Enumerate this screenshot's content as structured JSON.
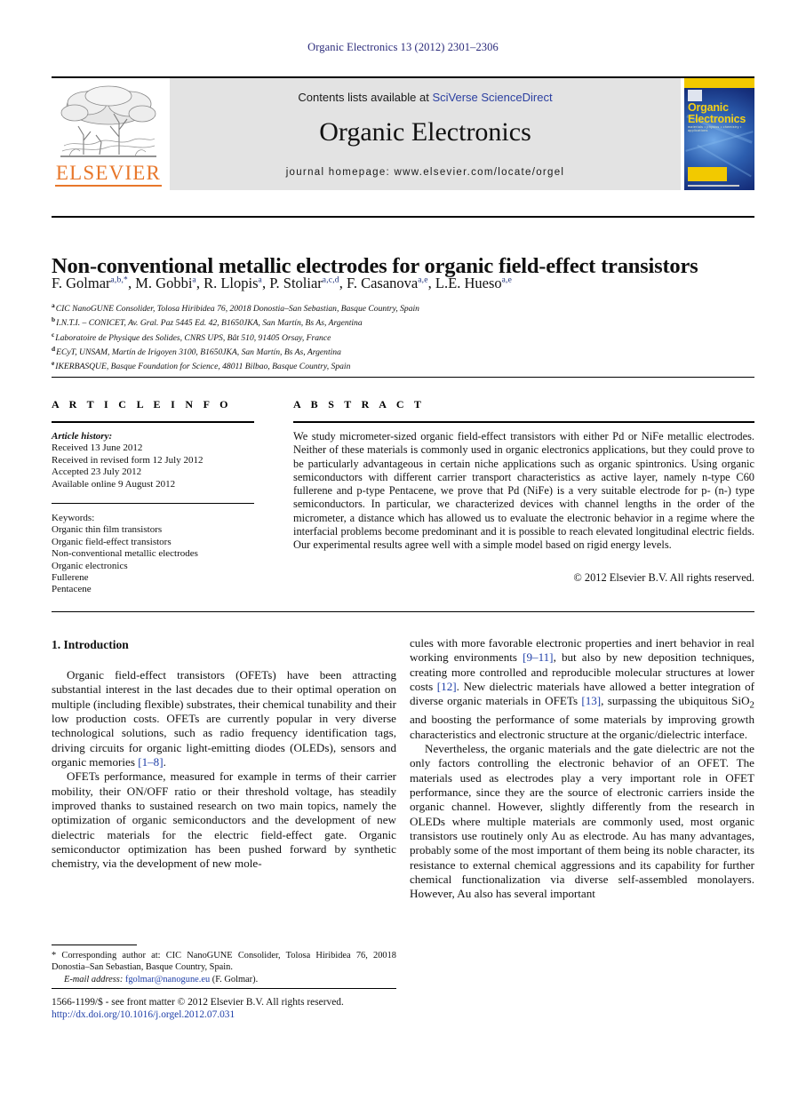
{
  "running_head": "Organic Electronics 13 (2012) 2301–2306",
  "masthead": {
    "contents_prefix": "Contents lists available at ",
    "contents_link": "SciVerse ScienceDirect",
    "journal_name": "Organic Electronics",
    "homepage": "journal homepage: www.elsevier.com/locate/orgel",
    "publisher_logo_text": "ELSEVIER",
    "cover": {
      "title_line1": "Organic",
      "title_line2": "Electronics",
      "subtitle": "materials • physics • chemistry • applications"
    }
  },
  "article": {
    "title": "Non-conventional metallic electrodes for organic field-effect transistors",
    "authors": [
      {
        "name": "F. Golmar",
        "sup": "a,b,*"
      },
      {
        "name": "M. Gobbi",
        "sup": "a"
      },
      {
        "name": "R. Llopis",
        "sup": "a"
      },
      {
        "name": "P. Stoliar",
        "sup": "a,c,d"
      },
      {
        "name": "F. Casanova",
        "sup": "a,e"
      },
      {
        "name": "L.E. Hueso",
        "sup": "a,e"
      }
    ],
    "affiliations": [
      {
        "mark": "a",
        "text": "CIC NanoGUNE Consolider, Tolosa Hiribidea 76, 20018 Donostia–San Sebastian, Basque Country, Spain"
      },
      {
        "mark": "b",
        "text": "I.N.T.I. – CONICET, Av. Gral. Paz 5445 Ed. 42, B1650JKA, San Martín, Bs As, Argentina"
      },
      {
        "mark": "c",
        "text": "Laboratoire de Physique des Solides, CNRS UPS, Bât 510, 91405 Orsay, France"
      },
      {
        "mark": "d",
        "text": "ECyT, UNSAM, Martín de Irigoyen 3100, B1650JKA, San Martín, Bs As, Argentina"
      },
      {
        "mark": "e",
        "text": "IKERBASQUE, Basque Foundation for Science, 48011 Bilbao, Basque Country, Spain"
      }
    ]
  },
  "article_info": {
    "heading": "A R T I C L E   I N F O",
    "history_label": "Article history:",
    "history": [
      "Received 13 June 2012",
      "Received in revised form 12 July 2012",
      "Accepted 23 July 2012",
      "Available online 9 August 2012"
    ],
    "keywords_label": "Keywords:",
    "keywords": [
      "Organic thin film transistors",
      "Organic field-effect transistors",
      "Non-conventional metallic electrodes",
      "Organic electronics",
      "Fullerene",
      "Pentacene"
    ]
  },
  "abstract": {
    "heading": "A B S T R A C T",
    "text": "We study micrometer-sized organic field-effect transistors with either Pd or NiFe metallic electrodes. Neither of these materials is commonly used in organic electronics applications, but they could prove to be particularly advantageous in certain niche applications such as organic spintronics. Using organic semiconductors with different carrier transport characteristics as active layer, namely n-type C60 fullerene and p-type Pentacene, we prove that Pd (NiFe) is a very suitable electrode for p- (n-) type semiconductors. In particular, we characterized devices with channel lengths in the order of the micrometer, a distance which has allowed us to evaluate the electronic behavior in a regime where the interfacial problems become predominant and it is possible to reach elevated longitudinal electric fields. Our experimental results agree well with a simple model based on rigid energy levels.",
    "copyright": "© 2012 Elsevier B.V. All rights reserved."
  },
  "body": {
    "section_title": "1. Introduction",
    "left_paragraphs": [
      "Organic field-effect transistors (OFETs) have been attracting substantial interest in the last decades due to their optimal operation on multiple (including flexible) substrates, their chemical tunability and their low production costs. OFETs are currently popular in very diverse technological solutions, such as radio frequency identification tags, driving circuits for organic light-emitting diodes (OLEDs), sensors and organic memories [1–8].",
      "OFETs performance, measured for example in terms of their carrier mobility, their ON/OFF ratio or their threshold voltage, has steadily improved thanks to sustained research on two main topics, namely the optimization of organic semiconductors and the development of new dielectric materials for the electric field-effect gate. Organic semiconductor optimization has been pushed forward by synthetic chemistry, via the development of new mole-"
    ],
    "right_paragraphs": [
      "cules with more favorable electronic properties and inert behavior in real working environments [9–11], but also by new deposition techniques, creating more controlled and reproducible molecular structures at lower costs [12]. New dielectric materials have allowed a better integration of diverse organic materials in OFETs [13], surpassing the ubiquitous SiO2 and boosting the performance of some materials by improving growth characteristics and electronic structure at the organic/dielectric interface.",
      "Nevertheless, the organic materials and the gate dielectric are not the only factors controlling the electronic behavior of an OFET. The materials used as electrodes play a very important role in OFET performance, since they are the source of electronic carriers inside the organic channel. However, slightly differently from the research in OLEDs where multiple materials are commonly used, most organic transistors use routinely only Au as electrode. Au has many advantages, probably some of the most important of them being its noble character, its resistance to external chemical aggressions and its capability for further chemical functionalization via diverse self-assembled monolayers. However, Au also has several important"
    ]
  },
  "footnote": {
    "marker": "*",
    "corresponding": "Corresponding author at: CIC NanoGUNE Consolider, Tolosa Hiribidea 76, 20018 Donostia–San Sebastian, Basque Country, Spain.",
    "email_label": "E-mail address:",
    "email": "fgolmar@nanogune.eu",
    "email_owner": "(F. Golmar)."
  },
  "publication_footer": {
    "line1": "1566-1199/$ - see front matter © 2012 Elsevier B.V. All rights reserved.",
    "doi": "http://dx.doi.org/10.1016/j.orgel.2012.07.031"
  },
  "colors": {
    "link_blue": "#1f3fa8",
    "running_head_blue": "#2a2a7a",
    "elsevier_orange": "#E8772A",
    "band_gray": "#e3e3e3",
    "cover_blue": "#0a1a52",
    "cover_yellow": "#f2c900"
  }
}
